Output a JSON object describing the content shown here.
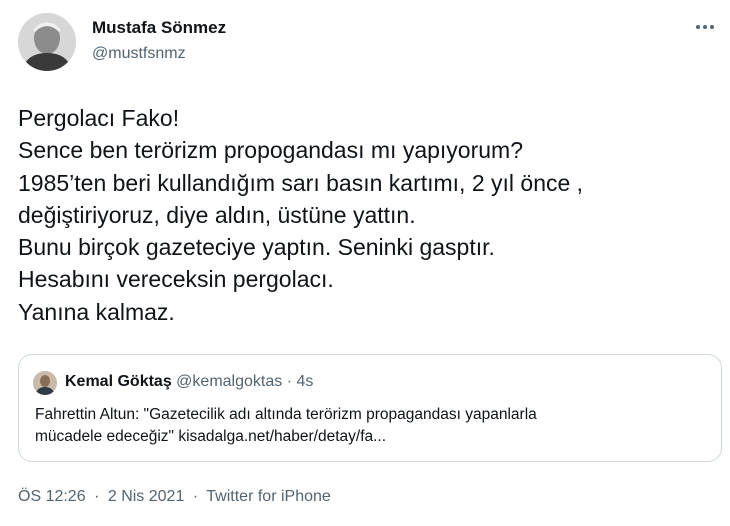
{
  "tweet": {
    "author": {
      "name": "Mustafa Sönmez",
      "handle": "@mustfsnmz"
    },
    "text_lines": [
      "Pergolacı Fako!",
      "Sence ben terörizm propogandası mı yapıyorum?",
      "1985’ten beri kullandığım sarı basın kartımı, 2 yıl önce ,",
      "değiştiriyoruz, diye aldın, üstüne yattın.",
      "Bunu birçok gazeteciye yaptın. Seninki gasptır.",
      "Hesabını vereceksin pergolacı.",
      "Yanına kalmaz."
    ],
    "quoted": {
      "name": "Kemal Göktaş",
      "handle": "@kemalgoktas",
      "time": "4s",
      "text_lines": [
        "Fahrettin Altun: \"Gazetecilik adı altında terörizm propagandası yapanlarla",
        "mücadele edeceğiz\" kisadalga.net/haber/detay/fa..."
      ]
    },
    "footer": {
      "time": "ÖS 12:26",
      "date": "2 Nis 2021",
      "source": "Twitter for iPhone",
      "separator": "·"
    }
  },
  "icons": {
    "more": "more-options-icon"
  }
}
